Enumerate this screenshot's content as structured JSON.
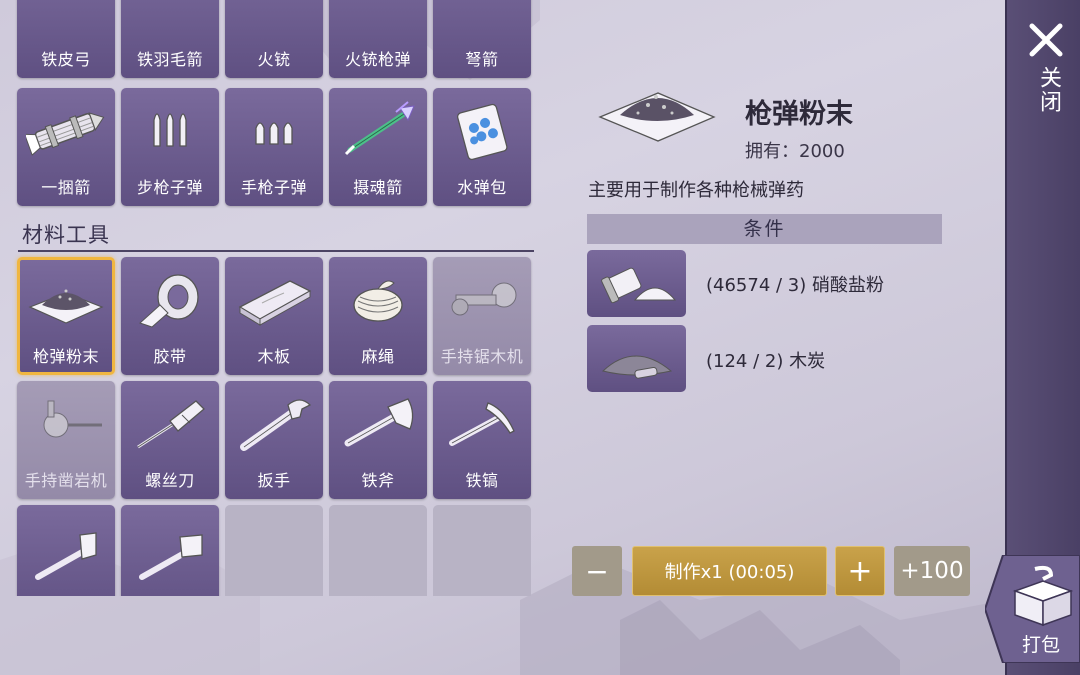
{
  "top_row_partial": [
    "铁皮弓",
    "铁羽毛箭",
    "火铳",
    "火铳枪弹",
    "弩箭"
  ],
  "ammo_row": [
    {
      "label": "一捆箭",
      "icon": "arrow-bundle-icon"
    },
    {
      "label": "步枪子弹",
      "icon": "rifle-bullets-icon"
    },
    {
      "label": "手枪子弹",
      "icon": "pistol-bullets-icon"
    },
    {
      "label": "摄魂箭",
      "icon": "soul-arrow-icon"
    },
    {
      "label": "水弹包",
      "icon": "water-bomb-pack-icon"
    }
  ],
  "section_title": "材料工具",
  "materials": [
    {
      "label": "枪弹粉末",
      "icon": "gunpowder-icon",
      "state": "selected"
    },
    {
      "label": "胶带",
      "icon": "tape-icon"
    },
    {
      "label": "木板",
      "icon": "wood-plank-icon"
    },
    {
      "label": "麻绳",
      "icon": "hemp-rope-icon"
    },
    {
      "label": "手持锯木机",
      "icon": "chainsaw-icon",
      "state": "dim"
    },
    {
      "label": "手持凿岩机",
      "icon": "rock-drill-icon",
      "state": "dim"
    },
    {
      "label": "螺丝刀",
      "icon": "screwdriver-icon"
    },
    {
      "label": "扳手",
      "icon": "wrench-icon"
    },
    {
      "label": "铁斧",
      "icon": "iron-axe-icon"
    },
    {
      "label": "铁镐",
      "icon": "iron-pickaxe-icon"
    }
  ],
  "detail": {
    "name": "枪弹粉末",
    "owned": "拥有：2000",
    "description": "主要用于制作各种枪械弹药",
    "conditions_header": "条件",
    "requirements": [
      {
        "text": "(46574 / 3) 硝酸盐粉",
        "icon": "nitrate-powder-icon"
      },
      {
        "text": "(124 / 2) 木炭",
        "icon": "charcoal-icon"
      }
    ]
  },
  "controls": {
    "minus": "−",
    "craft": "制作x1 (00:05)",
    "plus": "+",
    "plus100": "+100"
  },
  "sidebar": {
    "close_label": "关闭",
    "pack_label": "打包"
  },
  "colors": {
    "tile": "#6b5c8c",
    "selected_border": "#f0b640",
    "craft_button": "#c2993f",
    "sidebar": "#524770"
  }
}
